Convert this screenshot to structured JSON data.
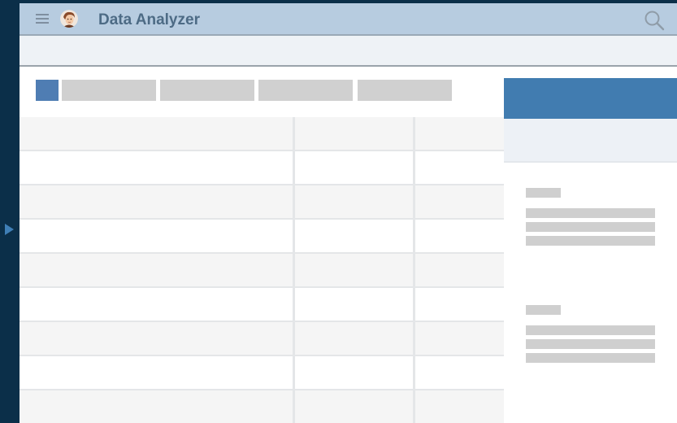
{
  "app": {
    "title": "Data Analyzer"
  },
  "colors": {
    "background": "#0b2f49",
    "titlebar": "#b7cce0",
    "accent": "#417cb0",
    "active_tab": "#4f7db3",
    "placeholder": "#d0d0d0"
  },
  "icons": {
    "menu": "hamburger-menu-icon",
    "user": "user-avatar",
    "search": "search-icon",
    "expand": "triangle-right-arrow"
  },
  "tabs": {
    "count_placeholder": 4
  },
  "table": {
    "columns": 3,
    "rows": 9
  },
  "side_panel": {
    "sections": 2,
    "lines_per_section": 3
  }
}
